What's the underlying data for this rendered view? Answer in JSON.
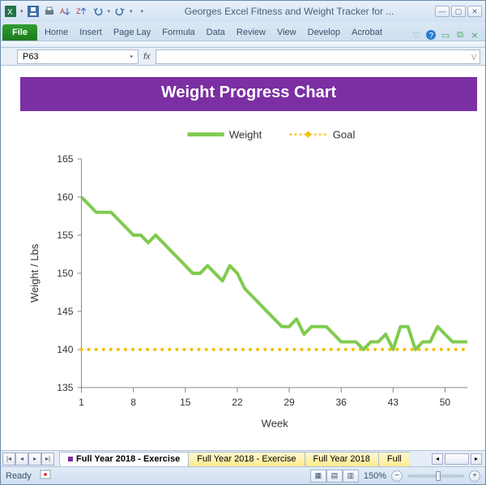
{
  "window": {
    "title": "Georges Excel Fitness and Weight Tracker for ..."
  },
  "ribbon": {
    "file": "File",
    "tabs": [
      "Home",
      "Insert",
      "Page Lay",
      "Formula",
      "Data",
      "Review",
      "View",
      "Develop",
      "Acrobat"
    ]
  },
  "namebox": {
    "cell": "P63",
    "fx": "fx"
  },
  "chart_title": "Weight Progress Chart",
  "chart_data": {
    "type": "line",
    "title": "Weight Progress Chart",
    "xlabel": "Week",
    "ylabel": "Weight / Lbs",
    "x_ticks": [
      1,
      8,
      15,
      22,
      29,
      36,
      43,
      50
    ],
    "y_ticks": [
      135,
      140,
      145,
      150,
      155,
      160,
      165
    ],
    "ylim": [
      135,
      165
    ],
    "xlim": [
      1,
      53
    ],
    "legend": [
      "Weight",
      "Goal"
    ],
    "series": [
      {
        "name": "Weight",
        "color": "#80cb4f",
        "x": [
          1,
          2,
          3,
          4,
          5,
          6,
          7,
          8,
          9,
          10,
          11,
          12,
          13,
          14,
          15,
          16,
          17,
          18,
          19,
          20,
          21,
          22,
          23,
          24,
          25,
          26,
          27,
          28,
          29,
          30,
          31,
          32,
          33,
          34,
          35,
          36,
          37,
          38,
          39,
          40,
          41,
          42,
          43,
          44,
          45,
          46,
          47,
          48,
          49,
          50,
          51,
          52,
          53
        ],
        "values": [
          160,
          159,
          158,
          158,
          158,
          157,
          156,
          155,
          155,
          154,
          155,
          154,
          153,
          152,
          151,
          150,
          150,
          151,
          150,
          149,
          151,
          150,
          148,
          147,
          146,
          145,
          144,
          143,
          143,
          144,
          142,
          143,
          143,
          143,
          142,
          141,
          141,
          141,
          140,
          141,
          141,
          142,
          140,
          143,
          143,
          140,
          141,
          141,
          143,
          142,
          141,
          141,
          141
        ]
      },
      {
        "name": "Goal",
        "color": "#f2c200",
        "x": [
          1,
          53
        ],
        "values": [
          140,
          140
        ]
      }
    ]
  },
  "sheet_tabs": [
    {
      "label": "Full Year 2018 - Exercise",
      "active": true
    },
    {
      "label": "Full Year 2018 - Exercise",
      "active": false
    },
    {
      "label": "Full Year 2018",
      "active": false
    },
    {
      "label": "Full",
      "active": false
    }
  ],
  "status": {
    "ready": "Ready",
    "zoom": "150%"
  }
}
